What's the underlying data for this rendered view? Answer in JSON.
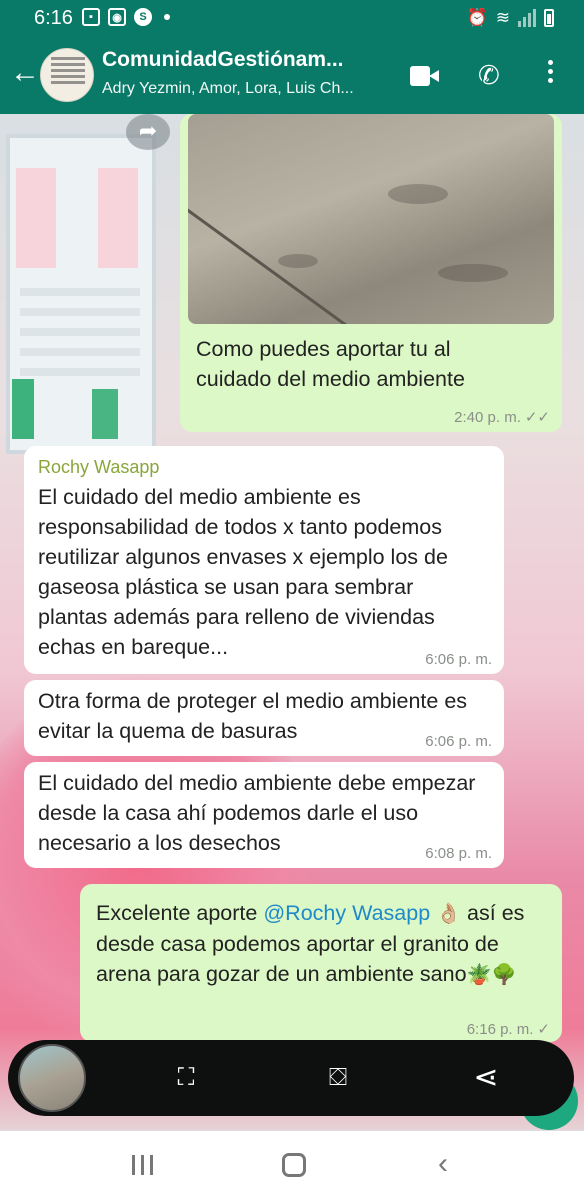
{
  "status_bar": {
    "time": "6:16",
    "icons": [
      "gallery-icon",
      "instagram-icon",
      "skype-icon",
      "dot-icon",
      "alarm-icon",
      "wifi-icon",
      "signal-icon",
      "battery-icon"
    ]
  },
  "header": {
    "title": "ComunidadGestiónam...",
    "subtitle": "Adry Yezmin, Amor, Lora, Luis Ch...",
    "icons": [
      "back-arrow-icon",
      "group-avatar",
      "video-call-icon",
      "phone-icon",
      "more-options-icon"
    ]
  },
  "messages": [
    {
      "direction": "outgoing",
      "has_image": true,
      "text": "Como puedes aportar tu al cuidado del medio ambiente",
      "time": "2:40 p. m.",
      "ticks": "✓✓"
    },
    {
      "direction": "incoming",
      "sender": "Rochy Wasapp",
      "text": "El cuidado del medio ambiente es responsabilidad de todos x tanto podemos reutilizar algunos envases x ejemplo los de gaseosa plástica se usan para sembrar plantas además para relleno de viviendas echas en bareque...",
      "time": "6:06 p. m."
    },
    {
      "direction": "incoming",
      "text": "Otra forma de proteger el medio ambiente es evitar la quema de basuras",
      "time": "6:06 p. m."
    },
    {
      "direction": "incoming",
      "text": "El cuidado del medio ambiente debe empezar desde la casa ahí podemos darle el uso necesario a los desechos",
      "time": "6:08 p. m."
    },
    {
      "direction": "outgoing",
      "text_before": "Excelente aporte ",
      "mention": "@Rochy Wasapp",
      "emoji_ok": "👌🏼",
      "text_after": "así es desde casa podemos aportar el granito de arena para gozar de un ambiente sano",
      "emoji_end": "🪴🌳",
      "time": "6:16 p. m.",
      "ticks": "✓"
    }
  ],
  "media_toolbar": {
    "icons": [
      "scan-icon",
      "crop-edit-icon",
      "share-icon"
    ],
    "glyphs": {
      "scan": "⛶",
      "crop": "⛋",
      "share": "⋖"
    }
  },
  "nav_bar": {
    "icons": [
      "recent-apps-icon",
      "home-icon",
      "back-icon"
    ],
    "back_glyph": "‹"
  },
  "colors": {
    "header": "#0a7a68",
    "outgoing_bubble": "#dcf8c6",
    "incoming_bubble": "#ffffff",
    "sender_name": "#8aa63a",
    "mention": "#1f8ac9"
  }
}
